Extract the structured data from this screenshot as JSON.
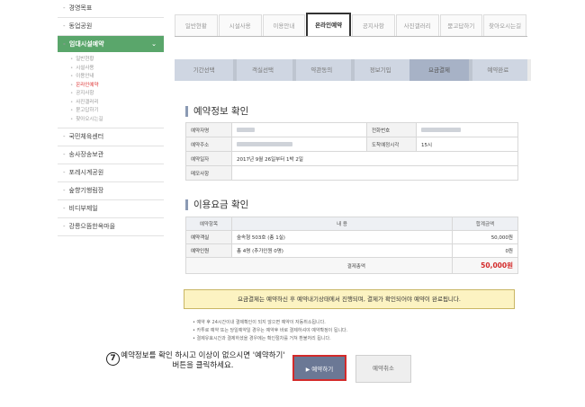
{
  "sidebar": {
    "items_top": [
      "경영목표",
      "동업공원"
    ],
    "active": "임대시설예약",
    "subitems": [
      "일반현황",
      "시설사용",
      "이용안내",
      "온라인예약",
      "공지사항",
      "사진갤러리",
      "묻고답하기",
      "찾아오시는길"
    ],
    "items_bottom": [
      "국민체육센터",
      "송사장송보관",
      "포레시계공원",
      "숲향기행림장",
      "비디부제일",
      "강릉으뜸한옥마을"
    ]
  },
  "tabs": [
    "일반현황",
    "시설사용",
    "이용안내",
    "온라인예약",
    "공지사항",
    "사진갤러리",
    "묻고답하기",
    "찾아오시는길"
  ],
  "steps": [
    "기간선택",
    "객실선택",
    "약관동의",
    "정보기입",
    "요금결제",
    "예약완료"
  ],
  "reservation": {
    "title": "예약정보 확인",
    "labels": {
      "name": "예약자명",
      "phone": "전화번호",
      "address": "예약주소",
      "arrival": "도착예정시각",
      "date": "예약일자",
      "note": "메모사항"
    },
    "arrival_value": "15시",
    "date_value": "2017년 9월 26일부터 1박 2일"
  },
  "fee": {
    "title": "이용요금 확인",
    "headers": [
      "예약항목",
      "내 용",
      "합계금액"
    ],
    "rows": [
      {
        "label": "예약객실",
        "content": "숲속형 503호 (총 1실)",
        "amount": "50,000원"
      },
      {
        "label": "예약인원",
        "content": "총 4명 (추가인원 0명)",
        "amount": "0원"
      }
    ],
    "total_label": "결제총액",
    "total_value": "50,000원"
  },
  "notice": "요금결제는 예약하신 후 예약내기상태에서 진행되며, 결제가 확인되어야 예약이 완료됩니다.",
  "notes": [
    "예약 후 24시간이내 결제확인이 되지 않으면 예약이 자동취소됩니다.",
    "카투로 예약 또는 당일예약일 경우는 예약후 바로 결제하셔야 예약확정이 됩니다.",
    "결제유효시간과 결제하셨을 경우에는 확인절차를 거쳐 환불처리 됩니다."
  ],
  "buttons": {
    "reserve": "예약하기",
    "cancel": "예약취소"
  },
  "annotation": {
    "number": "7",
    "text": "예약정보를 확인 하시고 이상이 없으시면 '예약하기' 버튼을 클릭하세요."
  },
  "colors": {
    "sidebar_active": "#5aa66b",
    "step_bar": "#cfd6e2",
    "reserve_button": "#6b7895",
    "highlight_border": "#d32a2a",
    "total_price": "#d32a2a",
    "notice_bg": "#fcf3c2"
  }
}
